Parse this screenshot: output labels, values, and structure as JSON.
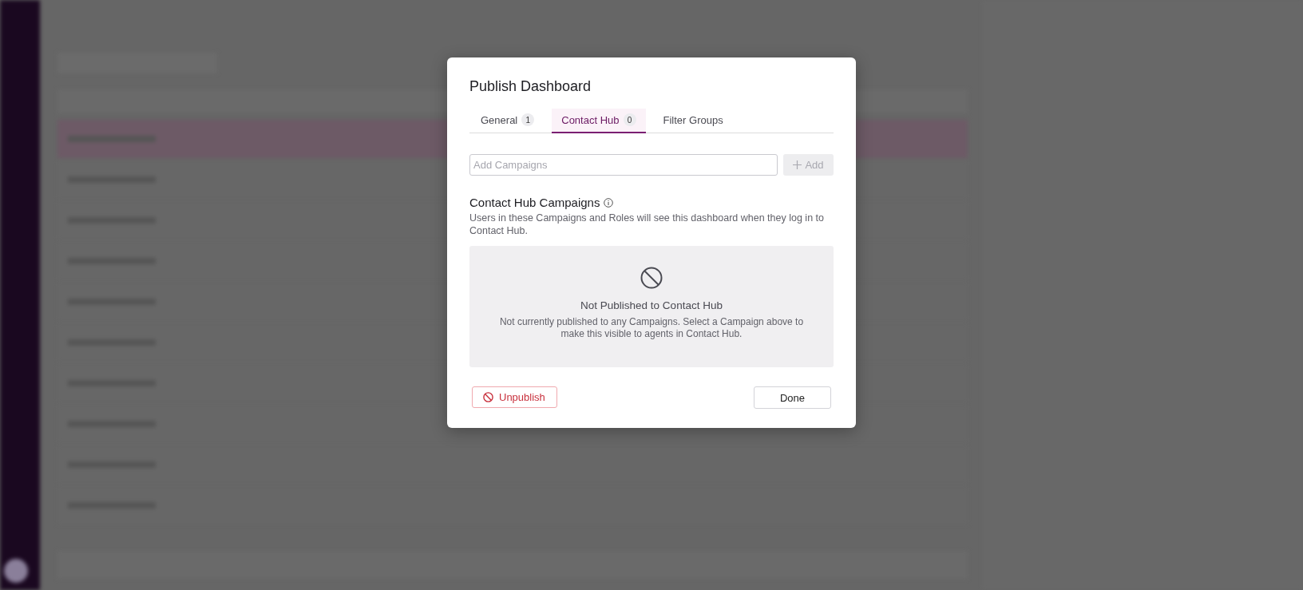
{
  "dialog": {
    "title": "Publish Dashboard",
    "tabs": [
      {
        "label": "General",
        "count": "1",
        "selected": false
      },
      {
        "label": "Contact Hub",
        "count": "0",
        "selected": true
      },
      {
        "label": "Filter Groups",
        "selected": false
      }
    ],
    "campaign_field": {
      "placeholder": "Add Campaigns"
    },
    "add_button": {
      "label": "Add",
      "disabled": true
    },
    "section": {
      "title": "Contact Hub Campaigns",
      "description": "Users in these Campaigns and Roles will see this dashboard when they log in to Contact Hub."
    },
    "empty_state": {
      "title": "Not Published to Contact Hub",
      "message": "Not currently published to any Campaigns. Select a Campaign above to make this visible to agents in Contact Hub."
    },
    "unpublish_button": {
      "label": "Unpublish"
    },
    "done_button": {
      "label": "Done"
    }
  }
}
